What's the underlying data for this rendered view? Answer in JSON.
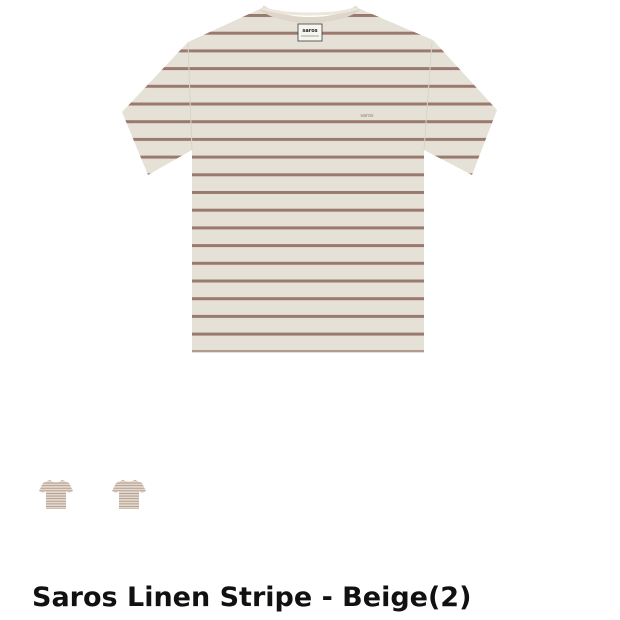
{
  "product": {
    "title": "Saros Linen Stripe - Beige(2)",
    "brand_label_text": "saros",
    "base_color": "#ebe6dc",
    "stripe_color": "#9e7d72"
  },
  "gallery": {
    "main_icon": "t-shirt-icon",
    "thumbnails": [
      {
        "icon": "t-shirt-thumbnail-front"
      },
      {
        "icon": "t-shirt-thumbnail-back"
      }
    ]
  }
}
